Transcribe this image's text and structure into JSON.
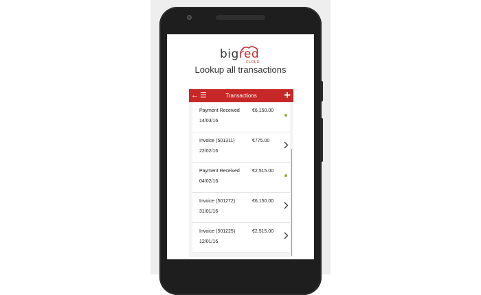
{
  "logo": {
    "word_left": "big",
    "word_right": "red",
    "sub": "CLOUD",
    "color": "#c62828"
  },
  "tagline": "Lookup all transactions",
  "appbar": {
    "back_icon": "←",
    "menu_icon": "☰",
    "title": "Transactions",
    "add_icon": "+",
    "color": "#c62828"
  },
  "transactions": [
    {
      "label": "Payment Received",
      "date": "14/03/16",
      "amount": "€6,150.00",
      "indicator": "status-dot",
      "indicator_color": "#8dae46"
    },
    {
      "label": "Invoice (501311)",
      "date": "22/02/16",
      "amount": "€775.00",
      "indicator": "chevron-right-icon"
    },
    {
      "label": "Payment Received",
      "date": "04/02/16",
      "amount": "€2,515.00",
      "indicator": "status-dot",
      "indicator_color": "#8dae46"
    },
    {
      "label": "Invoice (501272)",
      "date": "31/01/16",
      "amount": "€6,150.00",
      "indicator": "chevron-right-icon"
    },
    {
      "label": "Invoice (501225)",
      "date": "12/01/16",
      "amount": "€2,515.00",
      "indicator": "chevron-right-icon"
    }
  ]
}
